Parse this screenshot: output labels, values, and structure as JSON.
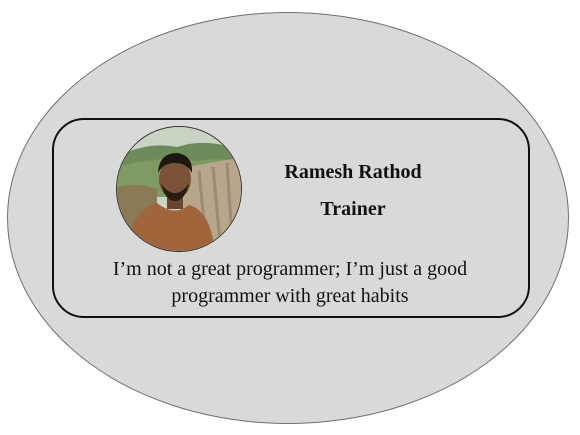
{
  "profile": {
    "name": "Ramesh Rathod",
    "role": "Trainer",
    "quote": "I’m not a great programmer; I’m just a good programmer with great habits",
    "photo_icon": "profile-photo"
  },
  "colors": {
    "background": "#ffffff",
    "ellipse_fill": "#d9d9d9",
    "ellipse_border": "#6f6f6f",
    "card_border": "#111111",
    "text": "#111111"
  }
}
